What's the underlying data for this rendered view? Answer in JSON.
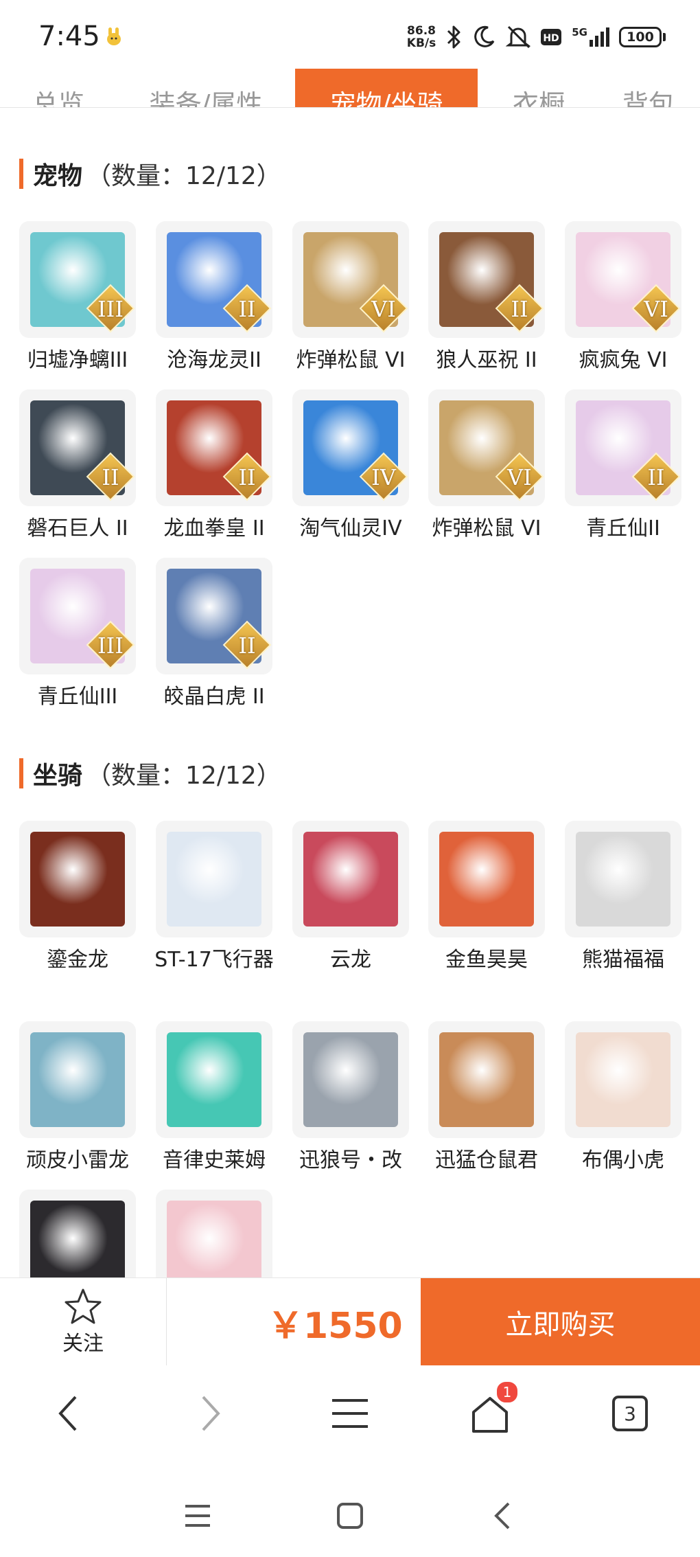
{
  "status_bar": {
    "time": "7:45",
    "net_speed_value": "86.8",
    "net_speed_unit": "KB/s",
    "signal_label": "5G",
    "battery": "100",
    "icons": [
      "bluetooth-icon",
      "moon-icon",
      "mute-bell-icon",
      "hd-icon",
      "signal-icon",
      "battery-icon"
    ]
  },
  "tabs": [
    {
      "label": "总览",
      "active": false
    },
    {
      "label": "装备/属性",
      "active": false
    },
    {
      "label": "宠物/坐骑",
      "active": true
    },
    {
      "label": "衣橱",
      "active": false
    },
    {
      "label": "背包",
      "active": false
    }
  ],
  "pets": {
    "title": "宠物",
    "count": "（数量：12/12）",
    "items": [
      {
        "name": "归墟净螭III",
        "tier": "III",
        "color": "#6fc8cf"
      },
      {
        "name": "沧海龙灵II",
        "tier": "II",
        "color": "#5a8fe0"
      },
      {
        "name": "炸弹松鼠 VI",
        "tier": "VI",
        "color": "#c9a56a"
      },
      {
        "name": "狼人巫祝 II",
        "tier": "II",
        "color": "#8a5a3a"
      },
      {
        "name": "疯疯兔 VI",
        "tier": "VI",
        "color": "#f1d0e3"
      },
      {
        "name": "磐石巨人 II",
        "tier": "II",
        "color": "#3f4a55"
      },
      {
        "name": "龙血拳皇 II",
        "tier": "II",
        "color": "#b5412e"
      },
      {
        "name": "淘气仙灵IV",
        "tier": "IV",
        "color": "#3a86d9"
      },
      {
        "name": "炸弹松鼠 VI",
        "tier": "VI",
        "color": "#c9a56a"
      },
      {
        "name": "青丘仙II",
        "tier": "II",
        "color": "#e6cbe9"
      },
      {
        "name": "青丘仙III",
        "tier": "III",
        "color": "#e6cbe9"
      },
      {
        "name": "皎晶白虎 II",
        "tier": "II",
        "color": "#5f7fb3"
      }
    ]
  },
  "mounts": {
    "title": "坐骑",
    "count": "（数量：12/12）",
    "items": [
      {
        "name": "鎏金龙",
        "color": "#7a2e1e"
      },
      {
        "name": "ST-17飞行器",
        "color": "#dfe8f2"
      },
      {
        "name": "云龙",
        "color": "#c94a5c"
      },
      {
        "name": "金鱼昊昊",
        "color": "#e0623a"
      },
      {
        "name": "熊猫福福",
        "color": "#d9d9d9"
      },
      {
        "name": "顽皮小雷龙",
        "color": "#7fb3c6"
      },
      {
        "name": "音律史莱姆",
        "color": "#46c7b4"
      },
      {
        "name": "迅狼号・改",
        "color": "#9aa3ad"
      },
      {
        "name": "迅猛仓鼠君",
        "color": "#c98b58"
      },
      {
        "name": "布偶小虎",
        "color": "#f1dcd0"
      },
      {
        "name": "",
        "color": "#2c2a2e"
      },
      {
        "name": "",
        "color": "#f3c7cf"
      }
    ]
  },
  "actions": {
    "follow_label": "关注",
    "price": "￥1550",
    "buy_label": "立即购买"
  },
  "browser_bar": {
    "badge_count": "1",
    "tabs_count": "3"
  },
  "colors": {
    "accent": "#ef6a2a"
  }
}
